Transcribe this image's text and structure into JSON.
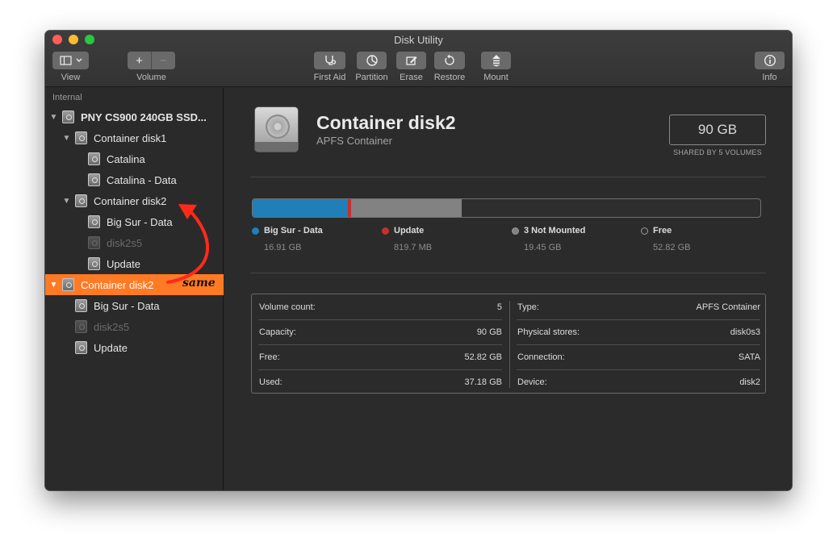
{
  "window": {
    "title": "Disk Utility"
  },
  "toolbar": {
    "view_label": "View",
    "volume_label": "Volume",
    "volume_add": "+",
    "volume_remove": "−",
    "first_aid_label": "First Aid",
    "partition_label": "Partition",
    "erase_label": "Erase",
    "restore_label": "Restore",
    "mount_label": "Mount",
    "info_label": "Info"
  },
  "sidebar": {
    "section": "Internal",
    "items": [
      {
        "label": "PNY CS900 240GB SSD...",
        "icon": "hard-disk-icon"
      },
      {
        "label": "Container disk1",
        "icon": "hard-disk-icon"
      },
      {
        "label": "Catalina",
        "icon": "hard-disk-icon"
      },
      {
        "label": "Catalina - Data",
        "icon": "hard-disk-icon"
      },
      {
        "label": "Container disk2",
        "icon": "hard-disk-icon"
      },
      {
        "label": "Big Sur - Data",
        "icon": "hard-disk-icon"
      },
      {
        "label": "disk2s5",
        "icon": "hard-disk-icon",
        "dimmed": true
      },
      {
        "label": "Update",
        "icon": "hard-disk-icon"
      },
      {
        "label": "Container disk2",
        "icon": "hard-disk-icon",
        "selected": true
      },
      {
        "label": "Big Sur - Data",
        "icon": "hard-disk-icon"
      },
      {
        "label": "disk2s5",
        "icon": "hard-disk-icon",
        "dimmed": true
      },
      {
        "label": "Update",
        "icon": "hard-disk-icon"
      }
    ]
  },
  "annotation": {
    "text": "same",
    "color": "#ff2a1a"
  },
  "device": {
    "name": "Container disk2",
    "type": "APFS Container",
    "size": "90 GB",
    "size_note": "SHARED BY 5 VOLUMES"
  },
  "usage": [
    {
      "name": "Big Sur - Data",
      "value": "16.91 GB",
      "color": "#1f7fb6"
    },
    {
      "name": "Update",
      "value": "819.7 MB",
      "color": "#c5302e"
    },
    {
      "name": "3 Not Mounted",
      "value": "19.45 GB",
      "color": "#828282"
    },
    {
      "name": "Free",
      "value": "52.82 GB",
      "color": "#2e2e2e"
    }
  ],
  "details": {
    "left": [
      {
        "label": "Volume count:",
        "value": "5"
      },
      {
        "label": "Capacity:",
        "value": "90 GB"
      },
      {
        "label": "Free:",
        "value": "52.82 GB"
      },
      {
        "label": "Used:",
        "value": "37.18 GB"
      }
    ],
    "right": [
      {
        "label": "Type:",
        "value": "APFS Container"
      },
      {
        "label": "Physical stores:",
        "value": "disk0s3"
      },
      {
        "label": "Connection:",
        "value": "SATA"
      },
      {
        "label": "Device:",
        "value": "disk2"
      }
    ]
  }
}
